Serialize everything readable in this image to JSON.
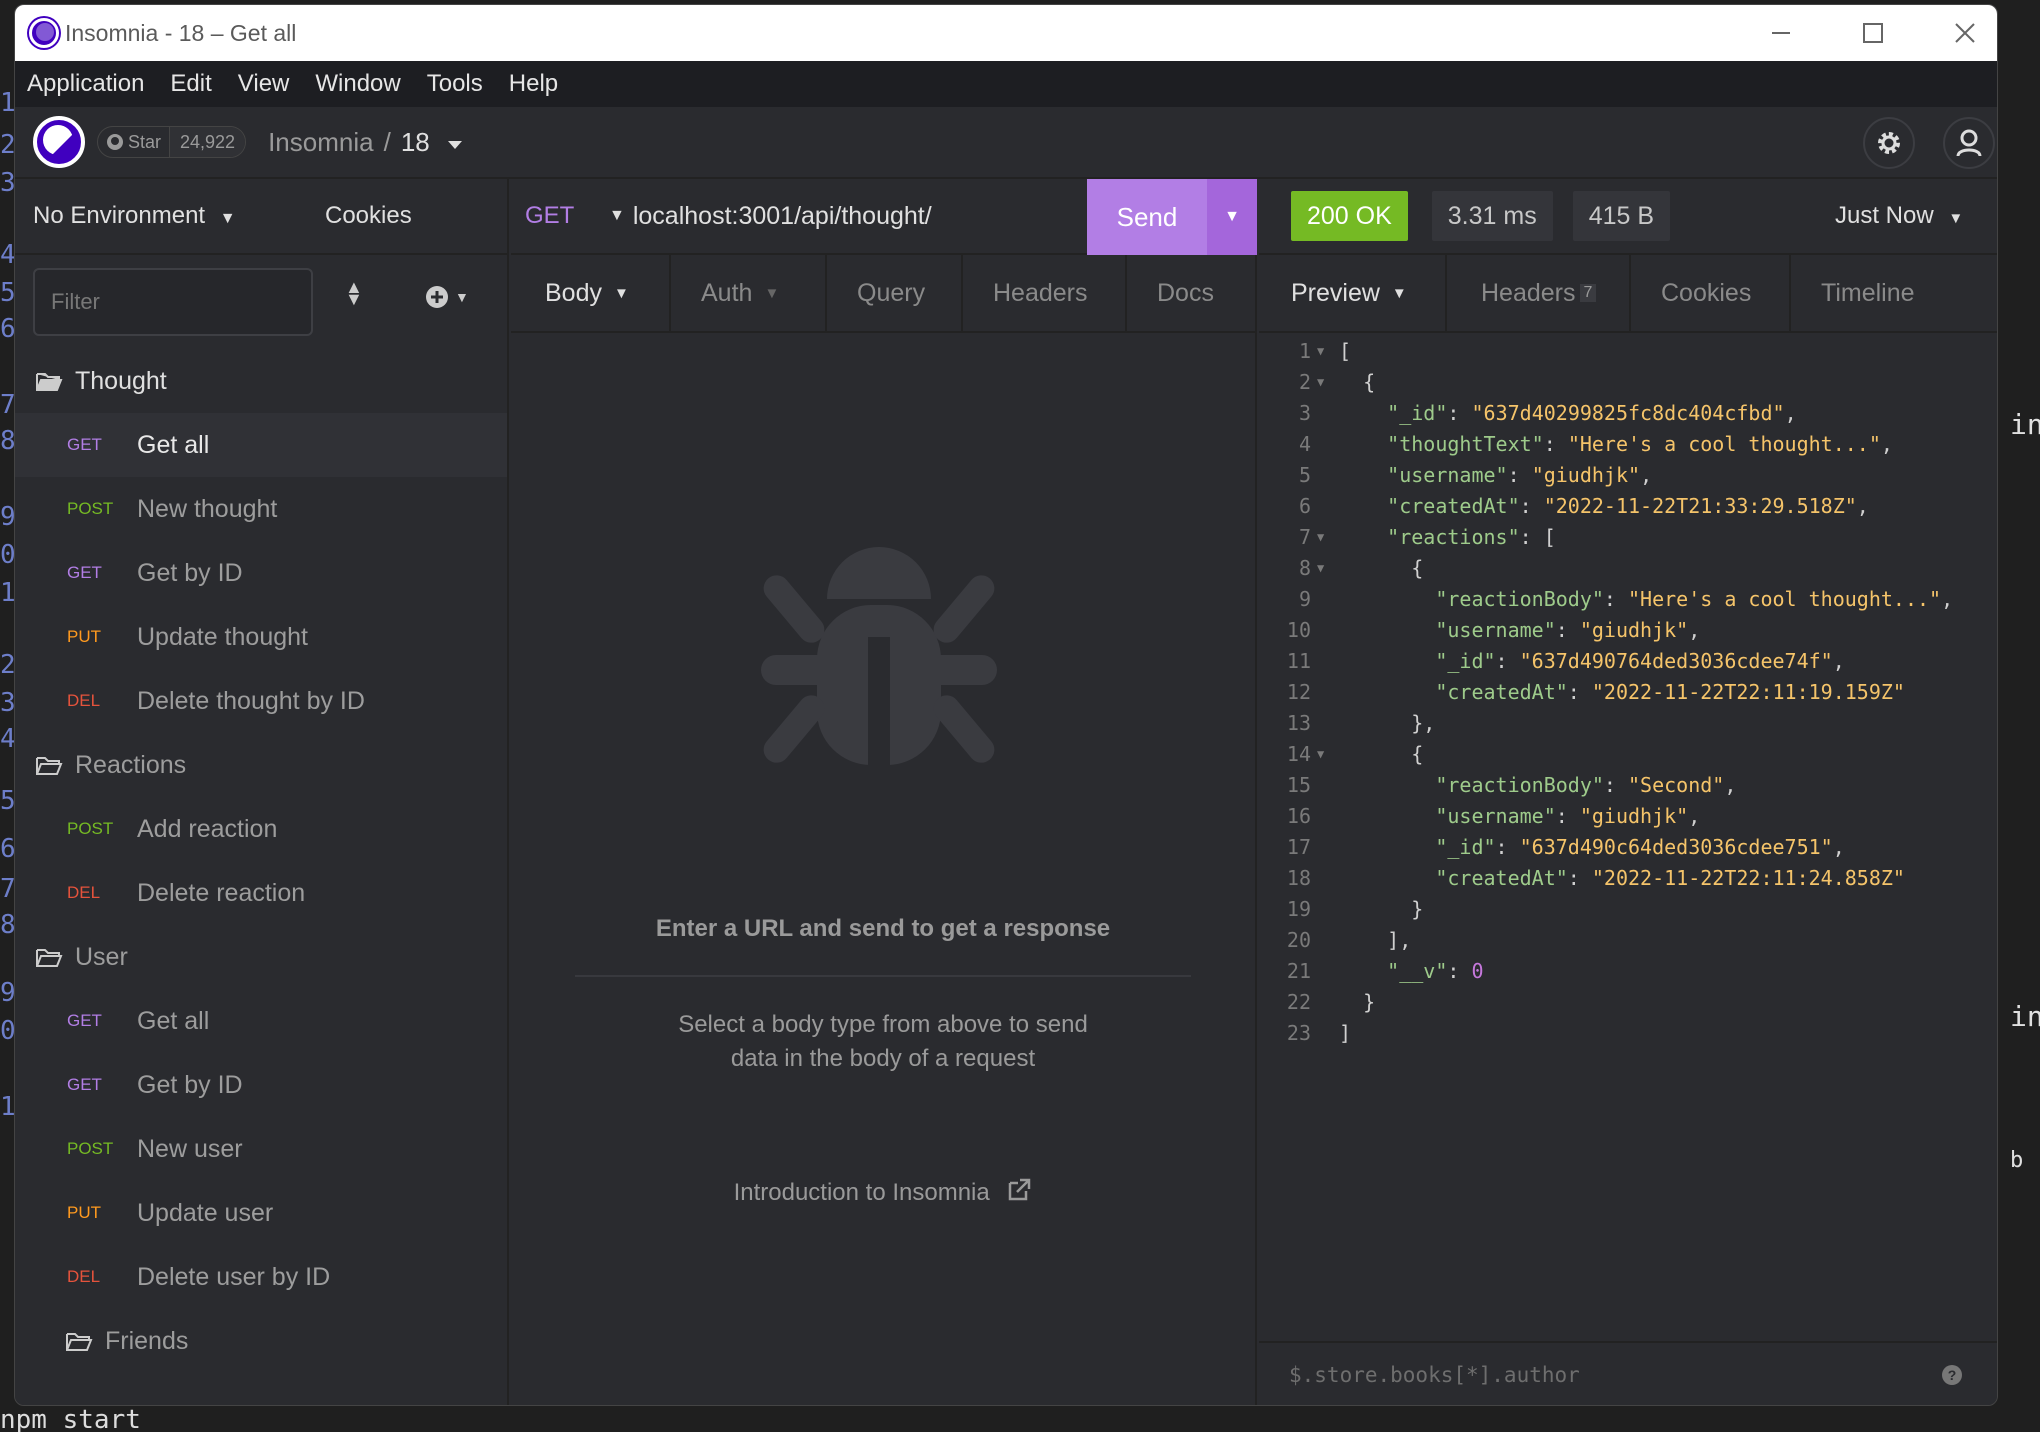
{
  "window": {
    "title": "Insomnia - 18 – Get all"
  },
  "menu": [
    "Application",
    "Edit",
    "View",
    "Window",
    "Tools",
    "Help"
  ],
  "topbar": {
    "star_label": "Star",
    "star_count": "24,922",
    "workspace": "Insomnia",
    "separator": "/",
    "project": "18"
  },
  "sidebar": {
    "environment": "No Environment",
    "cookies": "Cookies",
    "filter_placeholder": "Filter",
    "folders": [
      {
        "name": "Thought",
        "requests": [
          {
            "method": "GET",
            "name": "Get all",
            "active": true
          },
          {
            "method": "POST",
            "name": "New thought"
          },
          {
            "method": "GET",
            "name": "Get by ID"
          },
          {
            "method": "PUT",
            "name": "Update thought"
          },
          {
            "method": "DEL",
            "name": "Delete thought by ID"
          }
        ]
      },
      {
        "name": "Reactions",
        "requests": [
          {
            "method": "POST",
            "name": "Add reaction"
          },
          {
            "method": "DEL",
            "name": "Delete reaction"
          }
        ]
      },
      {
        "name": "User",
        "requests": [
          {
            "method": "GET",
            "name": "Get all"
          },
          {
            "method": "GET",
            "name": "Get by ID"
          },
          {
            "method": "POST",
            "name": "New user"
          },
          {
            "method": "PUT",
            "name": "Update user"
          },
          {
            "method": "DEL",
            "name": "Delete user by ID"
          }
        ]
      },
      {
        "name": "Friends",
        "requests": []
      }
    ]
  },
  "request": {
    "method": "GET",
    "url": "localhost:3001/api/thought/",
    "send": "Send",
    "tabs": [
      "Body",
      "Auth",
      "Query",
      "Headers",
      "Docs"
    ],
    "empty_title": "Enter a URL and send to get a response",
    "empty_desc_1": "Select a body type from above to send",
    "empty_desc_2": "data in the body of a request",
    "intro_link": "Introduction to Insomnia"
  },
  "response": {
    "status": "200 OK",
    "time": "3.31 ms",
    "size": "415 B",
    "when": "Just Now",
    "tabs": [
      "Preview",
      "Headers",
      "Cookies",
      "Timeline"
    ],
    "headers_count": "7",
    "filter_placeholder": "$.store.books[*].author",
    "lines": [
      [
        [
          "p",
          "["
        ]
      ],
      [
        [
          "p",
          "  {"
        ]
      ],
      [
        [
          "p",
          "    "
        ],
        [
          "k",
          "\"_id\""
        ],
        [
          "p",
          ": "
        ],
        [
          "s",
          "\"637d40299825fc8dc404cfbd\""
        ],
        [
          "p",
          ","
        ]
      ],
      [
        [
          "p",
          "    "
        ],
        [
          "k",
          "\"thoughtText\""
        ],
        [
          "p",
          ": "
        ],
        [
          "s",
          "\"Here's a cool thought...\""
        ],
        [
          "p",
          ","
        ]
      ],
      [
        [
          "p",
          "    "
        ],
        [
          "k",
          "\"username\""
        ],
        [
          "p",
          ": "
        ],
        [
          "s",
          "\"giudhjk\""
        ],
        [
          "p",
          ","
        ]
      ],
      [
        [
          "p",
          "    "
        ],
        [
          "k",
          "\"createdAt\""
        ],
        [
          "p",
          ": "
        ],
        [
          "s",
          "\"2022-11-22T21:33:29.518Z\""
        ],
        [
          "p",
          ","
        ]
      ],
      [
        [
          "p",
          "    "
        ],
        [
          "k",
          "\"reactions\""
        ],
        [
          "p",
          ": ["
        ]
      ],
      [
        [
          "p",
          "      {"
        ]
      ],
      [
        [
          "p",
          "        "
        ],
        [
          "k",
          "\"reactionBody\""
        ],
        [
          "p",
          ": "
        ],
        [
          "s",
          "\"Here's a cool thought...\""
        ],
        [
          "p",
          ","
        ]
      ],
      [
        [
          "p",
          "        "
        ],
        [
          "k",
          "\"username\""
        ],
        [
          "p",
          ": "
        ],
        [
          "s",
          "\"giudhjk\""
        ],
        [
          "p",
          ","
        ]
      ],
      [
        [
          "p",
          "        "
        ],
        [
          "k",
          "\"_id\""
        ],
        [
          "p",
          ": "
        ],
        [
          "s",
          "\"637d490764ded3036cdee74f\""
        ],
        [
          "p",
          ","
        ]
      ],
      [
        [
          "p",
          "        "
        ],
        [
          "k",
          "\"createdAt\""
        ],
        [
          "p",
          ": "
        ],
        [
          "s",
          "\"2022-11-22T22:11:19.159Z\""
        ]
      ],
      [
        [
          "p",
          "      },"
        ]
      ],
      [
        [
          "p",
          "      {"
        ]
      ],
      [
        [
          "p",
          "        "
        ],
        [
          "k",
          "\"reactionBody\""
        ],
        [
          "p",
          ": "
        ],
        [
          "s",
          "\"Second\""
        ],
        [
          "p",
          ","
        ]
      ],
      [
        [
          "p",
          "        "
        ],
        [
          "k",
          "\"username\""
        ],
        [
          "p",
          ": "
        ],
        [
          "s",
          "\"giudhjk\""
        ],
        [
          "p",
          ","
        ]
      ],
      [
        [
          "p",
          "        "
        ],
        [
          "k",
          "\"_id\""
        ],
        [
          "p",
          ": "
        ],
        [
          "s",
          "\"637d490c64ded3036cdee751\""
        ],
        [
          "p",
          ","
        ]
      ],
      [
        [
          "p",
          "        "
        ],
        [
          "k",
          "\"createdAt\""
        ],
        [
          "p",
          ": "
        ],
        [
          "s",
          "\"2022-11-22T22:11:24.858Z\""
        ]
      ],
      [
        [
          "p",
          "      }"
        ]
      ],
      [
        [
          "p",
          "    ],"
        ]
      ],
      [
        [
          "p",
          "    "
        ],
        [
          "k",
          "\"__v\""
        ],
        [
          "p",
          ": "
        ],
        [
          "v",
          "0"
        ]
      ],
      [
        [
          "p",
          "  }"
        ]
      ],
      [
        [
          "p",
          "]"
        ]
      ]
    ],
    "foldable": [
      1,
      2,
      7,
      8,
      14
    ]
  },
  "background": {
    "right_1": "in",
    "right_2": "ine",
    "right_3": "b",
    "bottom": "npm start"
  }
}
